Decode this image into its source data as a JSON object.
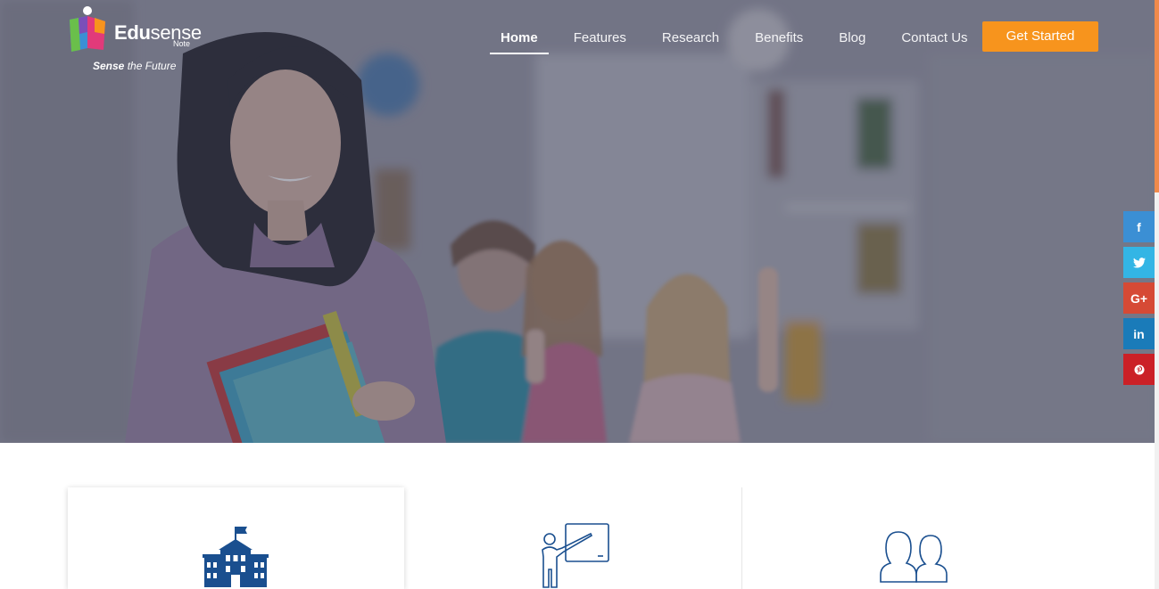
{
  "brand": {
    "name_bold": "Edu",
    "name_light": "sense",
    "sub": "Note",
    "tagline_bold": "Sense",
    "tagline_rest": " the Future"
  },
  "nav": {
    "items": [
      {
        "label": "Home",
        "active": true
      },
      {
        "label": "Features",
        "active": false
      },
      {
        "label": "Research",
        "active": false
      },
      {
        "label": "Benefits",
        "active": false
      },
      {
        "label": "Blog",
        "active": false
      },
      {
        "label": "Contact Us",
        "active": false
      }
    ],
    "cta_label": "Get Started"
  },
  "social": [
    {
      "name": "facebook",
      "glyph": "f",
      "color": "#3b8fd4"
    },
    {
      "name": "twitter",
      "glyph": "t",
      "color": "#33b5e5"
    },
    {
      "name": "google-plus",
      "glyph": "G+",
      "color": "#d64a35"
    },
    {
      "name": "linkedin",
      "glyph": "in",
      "color": "#1a7bb9"
    },
    {
      "name": "pinterest",
      "glyph": "P",
      "color": "#cb2027"
    }
  ],
  "colors": {
    "accent": "#f7941d",
    "icon_blue": "#1a4f8f"
  },
  "features": [
    {
      "icon": "school-building-icon"
    },
    {
      "icon": "teacher-board-icon"
    },
    {
      "icon": "users-icon"
    }
  ]
}
